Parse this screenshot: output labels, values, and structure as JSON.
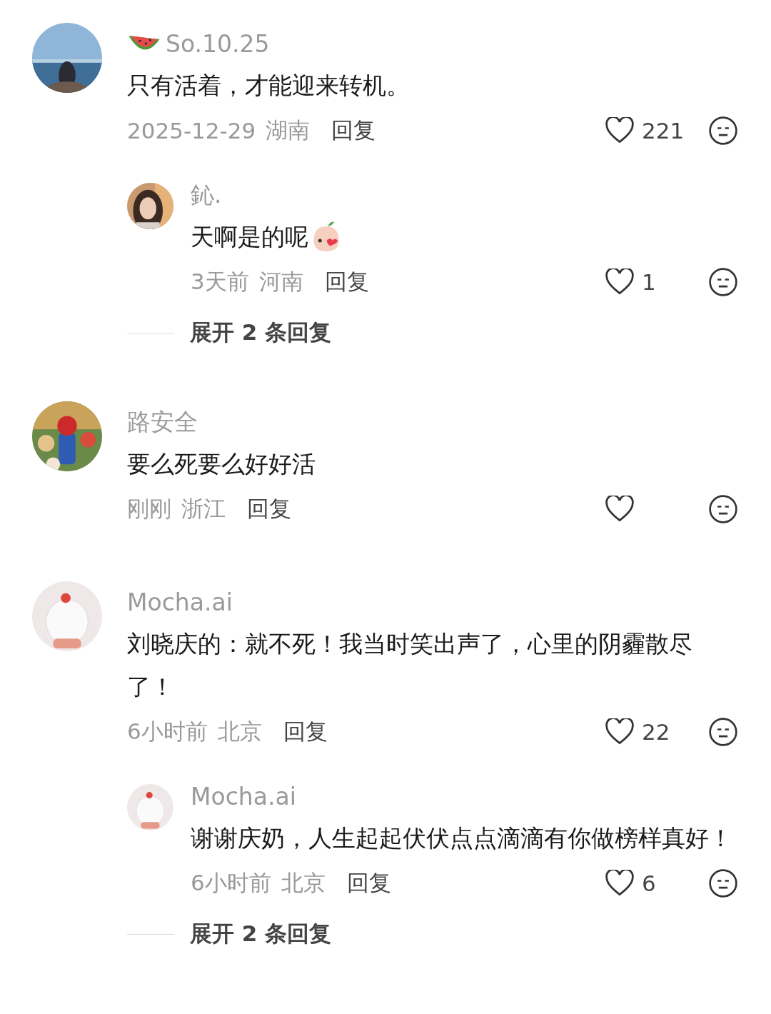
{
  "comments": [
    {
      "name": "So.10.25",
      "emoji": {
        "kind": "watermelon"
      },
      "text": "只有活着，才能迎来转机。",
      "date": "2025-12-29",
      "location": "湖南",
      "reply_label": "回复",
      "likes": "221",
      "replies": [
        {
          "name": "鈊.",
          "text": "天啊是的呢",
          "sticker": true,
          "date": "3天前",
          "location": "河南",
          "reply_label": "回复",
          "likes": "1"
        }
      ],
      "expand": "展开 2 条回复"
    },
    {
      "name": "路安全",
      "text": "要么死要么好好活",
      "date": "刚刚",
      "location": "浙江",
      "reply_label": "回复"
    },
    {
      "name": "Mocha.ai",
      "text": "刘晓庆的：就不死！我当时笑出声了，心里的阴霾散尽了！",
      "date": "6小时前",
      "location": "北京",
      "reply_label": "回复",
      "likes": "22",
      "replies": [
        {
          "name": "Mocha.ai",
          "text": "谢谢庆奶，人生起起伏伏点点滴滴有你做榜样真好！",
          "date": "6小时前",
          "location": "北京",
          "reply_label": "回复",
          "likes": "6"
        }
      ],
      "expand": "展开 2 条回复"
    }
  ]
}
